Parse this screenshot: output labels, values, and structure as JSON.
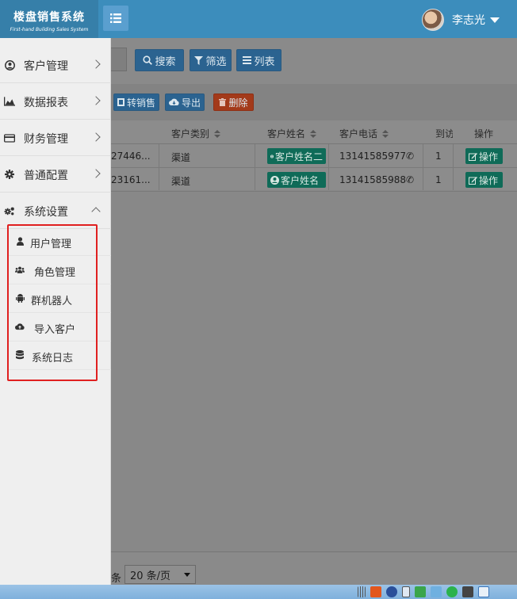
{
  "app": {
    "title": "楼盘销售系统",
    "subtitle": "First-hand Building Sales System"
  },
  "user": {
    "name": "李志光"
  },
  "toolbar": {
    "search": "搜索",
    "filter": "筛选",
    "list": "列表",
    "transfer": "转销售",
    "export": "导出",
    "delete": "删除"
  },
  "table": {
    "headers": {
      "category": "客户类别",
      "name": "客户姓名",
      "phone": "客户电话",
      "visit": "到访",
      "action": "操作"
    },
    "rows": [
      {
        "id": "27446...",
        "category": "渠道",
        "name": "客户姓名二",
        "phone": "13141585977",
        "visit": "1",
        "action": "操作"
      },
      {
        "id": "23161...",
        "category": "渠道",
        "name": "客户姓名",
        "phone": "13141585988",
        "visit": "1",
        "action": "操作"
      }
    ]
  },
  "pager": {
    "unit": "条",
    "page_size": "20 条/页"
  },
  "sidebar": {
    "items": [
      {
        "label": "客户管理",
        "icon": "user-circle-icon"
      },
      {
        "label": "数据报表",
        "icon": "area-chart-icon"
      },
      {
        "label": "财务管理",
        "icon": "credit-card-icon"
      },
      {
        "label": "普通配置",
        "icon": "gear-icon"
      },
      {
        "label": "系统设置",
        "icon": "gears-icon"
      }
    ],
    "subitems": [
      {
        "label": "用户管理",
        "icon": "user-icon"
      },
      {
        "label": "角色管理",
        "icon": "users-icon"
      },
      {
        "label": "群机器人",
        "icon": "android-icon"
      },
      {
        "label": "导入客户",
        "icon": "cloud-upload-icon"
      },
      {
        "label": "系统日志",
        "icon": "database-icon"
      }
    ]
  },
  "colors": {
    "header": "#3c8dbc",
    "logo": "#367fa9",
    "sidebar": "#efefef",
    "highlight": "#e02020"
  }
}
